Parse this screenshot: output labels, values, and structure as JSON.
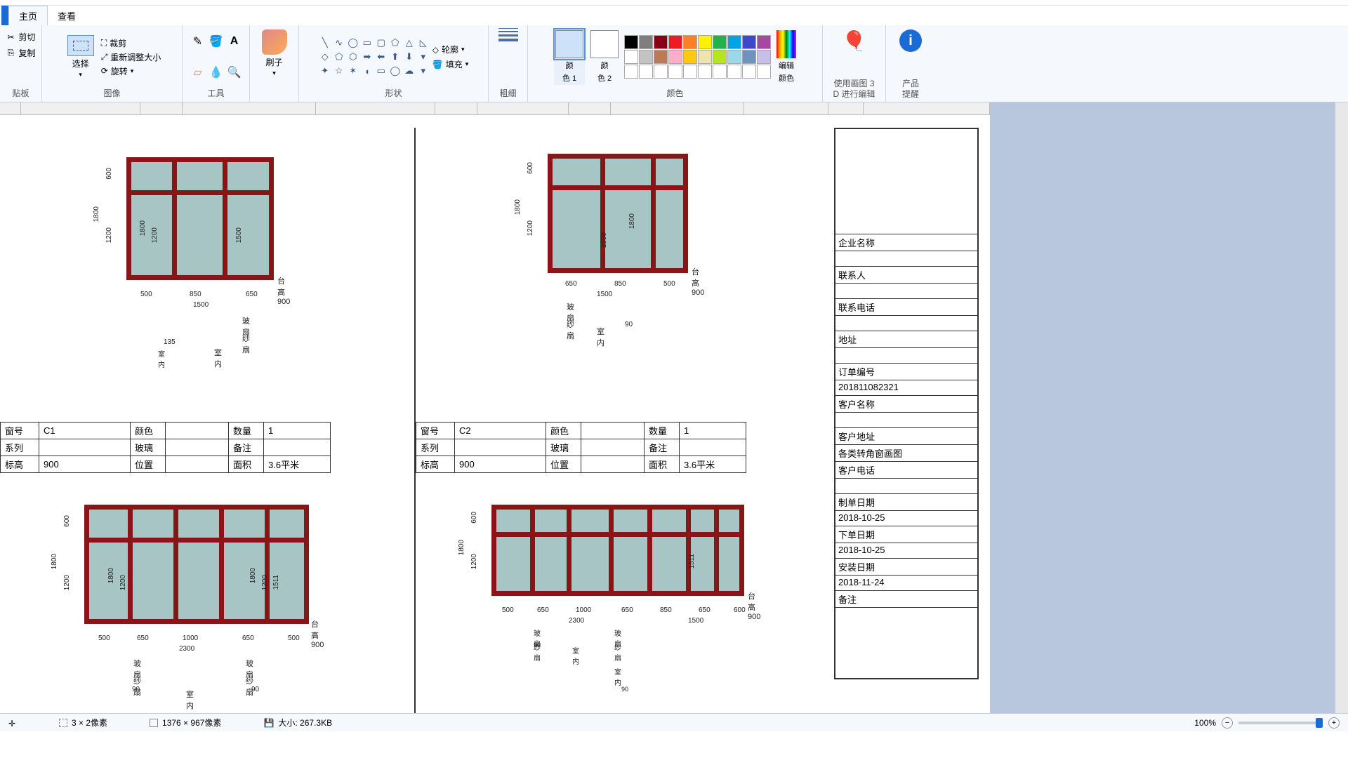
{
  "tabs": {
    "home": "主页",
    "view": "查看"
  },
  "ribbon": {
    "clipboard": {
      "cut": "剪切",
      "copy": "复制",
      "label": "贴板"
    },
    "image": {
      "crop": "裁剪",
      "resize": "重新调整大小",
      "rotate": "旋转",
      "select": "选择",
      "label": "图像"
    },
    "tools": {
      "label": "工具"
    },
    "shapes": {
      "outline": "轮廓",
      "fill": "填充",
      "label": "形状"
    },
    "brush": {
      "label": "刷子"
    },
    "size": {
      "label": "粗细"
    },
    "color1": {
      "label1": "颜",
      "label2": "色 1"
    },
    "color2": {
      "label1": "颜",
      "label2": "色 2"
    },
    "colors": {
      "label": "颜色"
    },
    "editcolors": {
      "label1": "编辑",
      "label2": "颜色"
    },
    "paint3d": {
      "label1": "使用画图 3",
      "label2": "D 进行编辑"
    },
    "product": {
      "label1": "产品",
      "label2": "提醒"
    }
  },
  "specTable1": {
    "r1c1": "窗号",
    "r1v1": "C1",
    "r1c2": "颜色",
    "r1v2": "",
    "r1c3": "数量",
    "r1v3": "1",
    "r2c1": "系列",
    "r2v1": "",
    "r2c2": "玻璃",
    "r2v2": "",
    "r2c3": "备注",
    "r2v3": "",
    "r3c1": "标高",
    "r3v1": "900",
    "r3c2": "位置",
    "r3v2": "",
    "r3c3": "面积",
    "r3v3": "3.6平米"
  },
  "specTable2": {
    "r1c1": "窗号",
    "r1v1": "C2",
    "r1c2": "颜色",
    "r1v2": "",
    "r1c3": "数量",
    "r1v3": "1",
    "r2c1": "系列",
    "r2v1": "",
    "r2c2": "玻璃",
    "r2v2": "",
    "r2c3": "备注",
    "r2v3": "",
    "r3c1": "标高",
    "r3v1": "900",
    "r3c2": "位置",
    "r3v2": "",
    "r3c3": "面积",
    "r3v3": "3.6平米"
  },
  "info": {
    "company": "企业名称",
    "contact": "联系人",
    "phone": "联系电话",
    "addr": "地址",
    "orderNo": "订单编号",
    "orderNoVal": "201811082321",
    "custName": "客户名称",
    "custAddr": "客户地址",
    "drawing": "各类转角窗画图",
    "custPhone": "客户电话",
    "makeDate": "制单日期",
    "makeDateVal": "2018-10-25",
    "orderDate": "下单日期",
    "orderDateVal": "2018-10-25",
    "installDate": "安装日期",
    "installDateVal": "2018-11-24",
    "remark": "备注"
  },
  "drawings": {
    "tai_gao": "台高900",
    "d1": {
      "w500": "500",
      "w850": "850",
      "w650": "650",
      "w1500": "1500",
      "h1800": "1800",
      "h1200": "1200",
      "h600": "600",
      "h1500": "1500"
    },
    "d2": {
      "w650": "650",
      "w850": "850",
      "w500": "500",
      "w1500": "1500",
      "h1800": "1800",
      "h1200": "1200",
      "h600": "600",
      "h1500": "1500"
    },
    "d3": {
      "w500": "500",
      "w650": "650",
      "w1000": "1000",
      "w2300": "2300",
      "h1800": "1800",
      "h1200": "1200",
      "h600": "600",
      "h1511": "1511"
    },
    "d4": {
      "w500": "500",
      "w650": "650",
      "w1000": "1000",
      "w850": "850",
      "w600": "600",
      "w2300": "2300",
      "w1500": "1500",
      "h1800": "1800",
      "h1200": "1200",
      "h600": "600",
      "h1511": "1511"
    },
    "labels": {
      "boshan": "玻扇",
      "shashan": "纱扇",
      "shinei": "室内",
      "n135": "135",
      "n90": "90"
    }
  },
  "status": {
    "sel": "3 × 2像素",
    "dim": "1376 × 967像素",
    "size": "大小: 267.3KB",
    "zoom": "100%"
  },
  "palette_row1": [
    "#000",
    "#7f7f7f",
    "#880015",
    "#ed1c24",
    "#ff7f27",
    "#fff200",
    "#22b14c",
    "#00a2e8",
    "#3f48cc",
    "#a349a4"
  ],
  "palette_row2": [
    "#fff",
    "#c3c3c3",
    "#b97a57",
    "#ffaec9",
    "#ffc90e",
    "#efe4b0",
    "#b5e61d",
    "#99d9ea",
    "#7092be",
    "#c8bfe7"
  ]
}
